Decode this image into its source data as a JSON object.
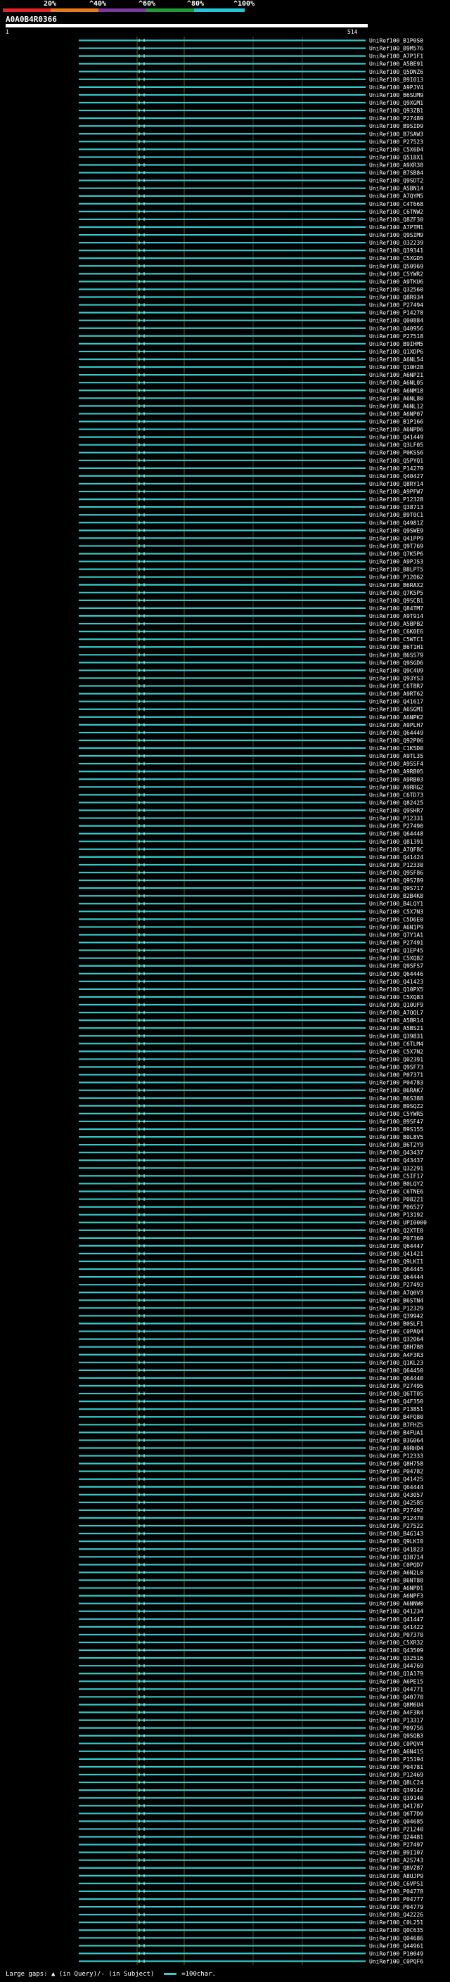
{
  "legend": {
    "ticks": [
      "20%",
      "^40%",
      "^60%",
      "^80%",
      "^100%"
    ],
    "colors": [
      "#e0252b",
      "#e87a1e",
      "#7a3c9a",
      "#1f9a3a",
      "#26c6d8"
    ]
  },
  "query": {
    "name": "A0A0B4R0366",
    "start": "1",
    "end": "514"
  },
  "footer": {
    "gaps_label": "Large gaps:",
    "gap_marker": "▲",
    "gaps_desc": "(in Query)/- (in Subject)",
    "scale_label": "=100char."
  },
  "chart_data": {
    "type": "alignment-overview",
    "query_length": 514,
    "hit_color": "#36c8c8",
    "background": "#000000",
    "hits": [
      "UniRef100_B1P0S0",
      "UniRef100_B9M576",
      "UniRef100_A7P1F1",
      "UniRef100_A5BE91",
      "UniRef100_Q5DNZ6",
      "UniRef100_B9I013",
      "UniRef100_A9PJV4",
      "UniRef100_B6SUM9",
      "UniRef100_Q9XGM1",
      "UniRef100_Q93ZB1",
      "UniRef100_P27489",
      "UniRef100_B9SID9",
      "UniRef100_B7SAW3",
      "UniRef100_P27523",
      "UniRef100_C5X6D4",
      "UniRef100_Q518X1",
      "UniRef100_A9XR38",
      "UniRef100_B7SB84",
      "UniRef100_Q9SDT2",
      "UniRef100_A5BN14",
      "UniRef100_A7QYM5",
      "UniRef100_C4T668",
      "UniRef100_C6TNW2",
      "UniRef100_Q8ZF30",
      "UniRef100_A7PTM1",
      "UniRef100_Q9SIM9",
      "UniRef100_O32239",
      "UniRef100_Q39341",
      "UniRef100_C5XGD5",
      "UniRef100_Q50969",
      "UniRef100_C5YWR2",
      "UniRef100_A9TKU6",
      "UniRef100_Q32560",
      "UniRef100_Q8R934",
      "UniRef100_P27494",
      "UniRef100_P14278",
      "UniRef100_Q00884",
      "UniRef100_Q40956",
      "UniRef100_P27518",
      "UniRef100_B9IHM5",
      "UniRef100_Q1XDP6",
      "UniRef100_A6NL54",
      "UniRef100_Q10H28",
      "UniRef100_A6NP21",
      "UniRef100_A6NL05",
      "UniRef100_A6NM18",
      "UniRef100_A6NL80",
      "UniRef100_A6NL12",
      "UniRef100_A6NP07",
      "UniRef100_B1P166",
      "UniRef100_A6NPD6",
      "UniRef100_Q41449",
      "UniRef100_Q3LF05",
      "UniRef100_P0KSS6",
      "UniRef100_Q5PYQ1",
      "UniRef100_P14279",
      "UniRef100_Q40427",
      "UniRef100_Q8RY14",
      "UniRef100_A9PFW7",
      "UniRef100_P12328",
      "UniRef100_Q38713",
      "UniRef100_B9T0C1",
      "UniRef100_Q4981Z",
      "UniRef100_Q9SWE9",
      "UniRef100_Q41PP9",
      "UniRef100_Q9T769",
      "UniRef100_Q7K5P6",
      "UniRef100_A9PJS3",
      "UniRef100_B8LPT5",
      "UniRef100_P12062",
      "UniRef100_B6RAX2",
      "UniRef100_Q7K5P5",
      "UniRef100_Q9SCB1",
      "UniRef100_Q84TM7",
      "UniRef100_A9T914",
      "UniRef100_A5BPB2",
      "UniRef100_C6K0E6",
      "UniRef100_C5WTC1",
      "UniRef100_B6T1H1",
      "UniRef100_B6SS79",
      "UniRef100_Q9SGD6",
      "UniRef100_Q9C4U9",
      "UniRef100_Q93YS3",
      "UniRef100_C6T8R7",
      "UniRef100_A9RT62",
      "UniRef100_Q41617",
      "UniRef100_A6SGM1",
      "UniRef100_A6NPK2",
      "UniRef100_A9PLH7",
      "UniRef100_Q64449",
      "UniRef100_Q92P06",
      "UniRef100_C1K5D0",
      "UniRef100_A9TL35",
      "UniRef100_A9SSF4",
      "UniRef100_A9RB05",
      "UniRef100_A9RB03",
      "UniRef100_A9RRG2",
      "UniRef100_C6TD73",
      "UniRef100_Q82425",
      "UniRef100_Q9SHR7",
      "UniRef100_P12331",
      "UniRef100_P27490",
      "UniRef100_Q64448",
      "UniRef100_Q81391",
      "UniRef100_A7QF8C",
      "UniRef100_Q41424",
      "UniRef100_P12330",
      "UniRef100_Q9SF86",
      "UniRef100_Q9S789",
      "UniRef100_Q9S717",
      "UniRef100_B2B4K8",
      "UniRef100_B4LQY1",
      "UniRef100_C5X7N3",
      "UniRef100_C5D6E0",
      "UniRef100_A6N1P9",
      "UniRef100_Q7Y1A1",
      "UniRef100_P27491",
      "UniRef100_Q1EP45",
      "UniRef100_C5XQ82",
      "UniRef100_Q9SFS7",
      "UniRef100_Q64446",
      "UniRef100_Q41423",
      "UniRef100_Q10PX5",
      "UniRef100_C5XQ83",
      "UniRef100_Q10UF9",
      "UniRef100_A7QQL7",
      "UniRef100_A5BR14",
      "UniRef100_A5BS21",
      "UniRef100_Q39831",
      "UniRef100_C6TLM4",
      "UniRef100_C5X7N2",
      "UniRef100_Q02391",
      "UniRef100_Q9SF73",
      "UniRef100_P07371",
      "UniRef100_P04783",
      "UniRef100_B6RAK7",
      "UniRef100_B6S388",
      "UniRef100_B9SQZ2",
      "UniRef100_C5YWR5",
      "UniRef100_B9SF47",
      "UniRef100_B9S155",
      "UniRef100_B0L8V5",
      "UniRef100_B6T2Y9",
      "UniRef100_Q43437",
      "UniRef100_Q43437",
      "UniRef100_Q32291",
      "UniRef100_C5IF17",
      "UniRef100_B0LQY2",
      "UniRef100_C6TNE6",
      "UniRef100_P08221",
      "UniRef100_P06527",
      "UniRef100_P13192",
      "UniRef100_UPI0000",
      "UniRef100_Q2XTE0",
      "UniRef100_P07369",
      "UniRef100_Q64447",
      "UniRef100_Q41421",
      "UniRef100_Q9LKI1",
      "UniRef100_Q64445",
      "UniRef100_Q64444",
      "UniRef100_P27493",
      "UniRef100_A7Q0V3",
      "UniRef100_B6STN4",
      "UniRef100_P12329",
      "UniRef100_Q39942",
      "UniRef100_B0SLF1",
      "UniRef100_C0PAQ4",
      "UniRef100_Q32064",
      "UniRef100_Q8H788",
      "UniRef100_A4F3R3",
      "UniRef100_Q1KL23",
      "UniRef100_Q64450",
      "UniRef100_Q64440",
      "UniRef100_P27495",
      "UniRef100_Q6TT05",
      "UniRef100_Q4F350",
      "UniRef100_P13851",
      "UniRef100_B4FQ80",
      "UniRef100_B7FHZ5",
      "UniRef100_B4FUA1",
      "UniRef100_B3G064",
      "UniRef100_A9RHD4",
      "UniRef100_P12333",
      "UniRef100_Q8H758",
      "UniRef100_P04782",
      "UniRef100_Q41425",
      "UniRef100_Q64444",
      "UniRef100_Q43057",
      "UniRef100_Q42585",
      "UniRef100_P27492",
      "UniRef100_P12470",
      "UniRef100_P27522",
      "UniRef100_B4G143",
      "UniRef100_Q9LKI0",
      "UniRef100_Q41823",
      "UniRef100_Q38714",
      "UniRef100_C0PQD7",
      "UniRef100_A6N2L0",
      "UniRef100_B6NT88",
      "UniRef100_A6NPD1",
      "UniRef100_A6NPF3",
      "UniRef100_A6NNW0",
      "UniRef100_Q41234",
      "UniRef100_Q41447",
      "UniRef100_Q41422",
      "UniRef100_P07370",
      "UniRef100_C5XR32",
      "UniRef100_Q43509",
      "UniRef100_Q32516",
      "UniRef100_Q44769",
      "UniRef100_Q1A179",
      "UniRef100_A6PE15",
      "UniRef100_Q44771",
      "UniRef100_Q40770",
      "UniRef100_Q8M6U4",
      "UniRef100_A4F3R4",
      "UniRef100_P13317",
      "UniRef100_P09756",
      "UniRef100_Q9SQB3",
      "UniRef100_C0PQV4",
      "UniRef100_A6N415",
      "UniRef100_P15194",
      "UniRef100_P04781",
      "UniRef100_P12469",
      "UniRef100_Q8LC24",
      "UniRef100_Q39142",
      "UniRef100_Q39140",
      "UniRef100_Q41787",
      "UniRef100_Q6T7D9",
      "UniRef100_Q04685",
      "UniRef100_P21240",
      "UniRef100_Q24481",
      "UniRef100_P27497",
      "UniRef100_B9I107",
      "UniRef100_A2S743",
      "UniRef100_Q8VZ87",
      "UniRef100_A8UJP9",
      "UniRef100_C6VPS1",
      "UniRef100_P04778",
      "UniRef100_P04777",
      "UniRef100_P04779",
      "UniRef100_Q42226",
      "UniRef100_C0L251",
      "UniRef100_Q0C635",
      "UniRef100_Q04686",
      "UniRef100_Q44961",
      "UniRef100_P10049",
      "UniRef100_C0PQF6"
    ]
  }
}
